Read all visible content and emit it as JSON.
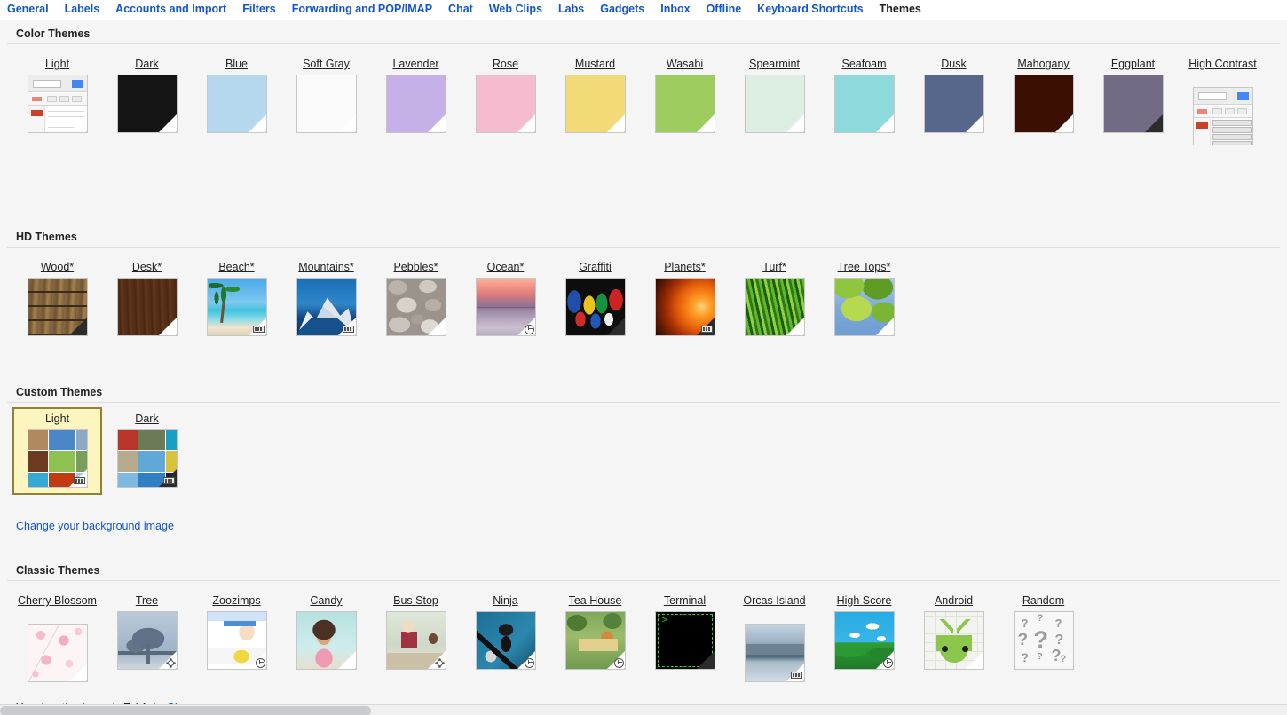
{
  "tabs": [
    {
      "label": "General",
      "active": false
    },
    {
      "label": "Labels",
      "active": false
    },
    {
      "label": "Accounts and Import",
      "active": false
    },
    {
      "label": "Filters",
      "active": false
    },
    {
      "label": "Forwarding and POP/IMAP",
      "active": false
    },
    {
      "label": "Chat",
      "active": false
    },
    {
      "label": "Web Clips",
      "active": false
    },
    {
      "label": "Labs",
      "active": false
    },
    {
      "label": "Gadgets",
      "active": false
    },
    {
      "label": "Inbox",
      "active": false
    },
    {
      "label": "Offline",
      "active": false
    },
    {
      "label": "Keyboard Shortcuts",
      "active": false
    },
    {
      "label": "Themes",
      "active": true
    }
  ],
  "sections": {
    "color_themes": {
      "title": "Color Themes",
      "items": [
        {
          "label": "Light",
          "kind": "mock",
          "color": "#ffffff",
          "fold": "light",
          "badge": null
        },
        {
          "label": "Dark",
          "kind": "solid",
          "color": "#141414",
          "fold": "light",
          "badge": null
        },
        {
          "label": "Blue",
          "kind": "solid",
          "color": "#b5d8ef",
          "fold": "light",
          "badge": null
        },
        {
          "label": "Soft Gray",
          "kind": "solid",
          "color": "#fafafa",
          "fold": "light",
          "badge": null
        },
        {
          "label": "Lavender",
          "kind": "solid",
          "color": "#c5b1e8",
          "fold": "light",
          "badge": null
        },
        {
          "label": "Rose",
          "kind": "solid",
          "color": "#f4bcce",
          "fold": "light",
          "badge": null
        },
        {
          "label": "Mustard",
          "kind": "solid",
          "color": "#f2da78",
          "fold": "light",
          "badge": null
        },
        {
          "label": "Wasabi",
          "kind": "solid",
          "color": "#9ecc5f",
          "fold": "light",
          "badge": null
        },
        {
          "label": "Spearmint",
          "kind": "solid",
          "color": "#ddeee2",
          "fold": "light",
          "badge": null
        },
        {
          "label": "Seafoam",
          "kind": "solid",
          "color": "#8ed9dc",
          "fold": "light",
          "badge": null
        },
        {
          "label": "Dusk",
          "kind": "solid",
          "color": "#57678c",
          "fold": "light",
          "badge": null
        },
        {
          "label": "Mahogany",
          "kind": "solid",
          "color": "#3c0f03",
          "fold": "light",
          "badge": null
        },
        {
          "label": "Eggplant",
          "kind": "solid",
          "color": "#736b86",
          "fold": "dark",
          "badge": null
        },
        {
          "label": "High Contrast",
          "kind": "mockhc",
          "color": "#ffffff",
          "fold": "none",
          "badge": null
        }
      ]
    },
    "hd_themes": {
      "title": "HD Themes",
      "items": [
        {
          "label": "Wood*",
          "kind": "photo",
          "art": "ph-wood",
          "fold": "dark",
          "badge": null
        },
        {
          "label": "Desk*",
          "kind": "photo",
          "art": "ph-desk",
          "fold": "light",
          "badge": null
        },
        {
          "label": "Beach*",
          "kind": "photo",
          "art": "ph-beach",
          "fold": "light",
          "badge": "tiles"
        },
        {
          "label": "Mountains*",
          "kind": "photo",
          "art": "ph-mount",
          "fold": "light",
          "badge": "tiles"
        },
        {
          "label": "Pebbles*",
          "kind": "photo",
          "art": "ph-pebbles",
          "fold": "light",
          "badge": null
        },
        {
          "label": "Ocean*",
          "kind": "photo",
          "art": "ph-ocean",
          "fold": "light",
          "badge": "clock"
        },
        {
          "label": "Graffiti",
          "kind": "photo",
          "art": "ph-graffiti",
          "fold": "dark",
          "badge": null
        },
        {
          "label": "Planets*",
          "kind": "photo",
          "art": "ph-planets",
          "fold": "dark",
          "badge": "tiles"
        },
        {
          "label": "Turf*",
          "kind": "photo",
          "art": "ph-turf",
          "fold": "light",
          "badge": null
        },
        {
          "label": "Tree Tops*",
          "kind": "photo",
          "art": "ph-treetops",
          "fold": "light",
          "badge": null
        }
      ]
    },
    "custom_themes": {
      "title": "Custom Themes",
      "change_background_link": "Change your background image",
      "items": [
        {
          "label": "Light",
          "kind": "collage",
          "variant": "light",
          "fold": "light",
          "badge": "tiles",
          "selected": true
        },
        {
          "label": "Dark",
          "kind": "collage",
          "variant": "dark",
          "fold": "dark",
          "badge": "tiles",
          "selected": false
        }
      ]
    },
    "classic_themes": {
      "title": "Classic Themes",
      "items": [
        {
          "label": "Cherry Blossom",
          "kind": "photo",
          "art": "ph-cherry",
          "fold": "light",
          "badge": null
        },
        {
          "label": "Tree",
          "kind": "photo",
          "art": "ph-tree",
          "fold": "light",
          "badge": "sun"
        },
        {
          "label": "Zoozimps",
          "kind": "photo",
          "art": "ph-zoo",
          "fold": "light",
          "badge": "clock"
        },
        {
          "label": "Candy",
          "kind": "photo",
          "art": "ph-candy",
          "fold": "light",
          "badge": null
        },
        {
          "label": "Bus Stop",
          "kind": "photo",
          "art": "ph-busstop",
          "fold": "light",
          "badge": "sun"
        },
        {
          "label": "Ninja",
          "kind": "photo",
          "art": "ph-ninja",
          "fold": "light",
          "badge": "clock"
        },
        {
          "label": "Tea House",
          "kind": "photo",
          "art": "ph-teahouse",
          "fold": "light",
          "badge": "clock"
        },
        {
          "label": "Terminal",
          "kind": "terminal",
          "art": "ph-terminal",
          "fold": "dark",
          "badge": null,
          "prompt": ">"
        },
        {
          "label": "Orcas Island",
          "kind": "photo",
          "art": "ph-orcas",
          "fold": "light",
          "badge": "tiles"
        },
        {
          "label": "High Score",
          "kind": "photo",
          "art": "ph-highscore",
          "fold": "light",
          "badge": "clock"
        },
        {
          "label": "Android",
          "kind": "photo",
          "art": "ph-android",
          "fold": "light",
          "badge": null
        },
        {
          "label": "Random",
          "kind": "random",
          "art": "ph-random",
          "fold": "none",
          "badge": null
        }
      ]
    }
  },
  "footer": {
    "location_text": "Your location is set to Tel Aviv.",
    "change_link": "Change"
  },
  "collage_tiles": {
    "light": [
      "#b08a5e",
      "#4a86c8",
      "#8fa8c4",
      "#6b3a1f",
      "#8fc151",
      "#7a9d5a",
      "#36a8d4",
      "#c23a12",
      "#9ec7e8"
    ],
    "dark": [
      "#b8372a",
      "#6d7a58",
      "#1a9fc4",
      "#b6a98d",
      "#5fa8d8",
      "#d8c23a",
      "#7fb8e0",
      "#2f7fc4",
      "#1f1f1f"
    ]
  }
}
